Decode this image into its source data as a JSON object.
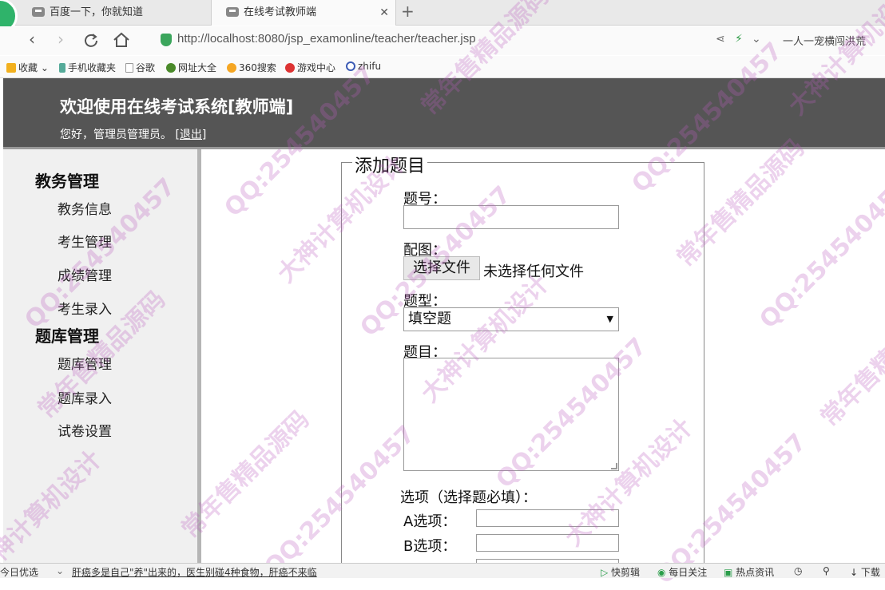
{
  "browser": {
    "tabs": [
      {
        "title": "百度一下，你就知道",
        "active": false
      },
      {
        "title": "在线考试教师端",
        "active": true
      }
    ],
    "url": "http://localhost:8080/jsp_examonline/teacher/teacher.jsp",
    "search_hint": "一人一宠横闯洪荒"
  },
  "bookmarks": [
    "收藏",
    "手机收藏夹",
    "谷歌",
    "网址大全",
    "360搜索",
    "游戏中心",
    "zhifu"
  ],
  "header": {
    "title": "欢迎使用在线考试系统[教师端]",
    "greeting": "您好，管理员管理员。",
    "logout": "[退出]"
  },
  "sidebar": {
    "sections": [
      {
        "title": "教务管理",
        "items": [
          "教务信息",
          "考生管理",
          "成绩管理",
          "考生录入"
        ]
      },
      {
        "title": "题库管理",
        "items": [
          "题库管理",
          "题库录入",
          "试卷设置"
        ]
      }
    ]
  },
  "form": {
    "legend": "添加题目",
    "number_label": "题号：",
    "image_label": "配图：",
    "file_button": "选择文件",
    "file_status": "未选择任何文件",
    "type_label": "题型：",
    "type_value": "填空题",
    "question_label": "题目：",
    "options_label": "选项（选择题必填）：",
    "option_a": "A选项：",
    "option_b": "B选项："
  },
  "statusbar": {
    "left": "今日优选",
    "news": "肝癌多是自己\"养\"出来的，医生别碰4种食物，肝癌不来临",
    "items": [
      "快剪辑",
      "每日关注",
      "热点资讯",
      "下载"
    ]
  },
  "watermarks": [
    "QQ:254540457",
    "常年售精品源码",
    "大神计算机设计"
  ],
  "colors": {
    "header_bg": "#555555",
    "sidebar_bg": "#f0f0f0",
    "watermark": "#b95fbe"
  }
}
